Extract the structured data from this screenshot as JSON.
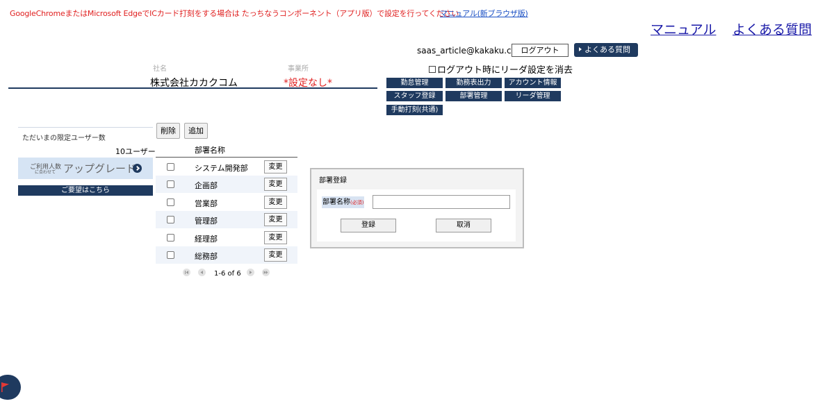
{
  "notice": {
    "text": "GoogleChromeまたはMicrosoft EdgeでICカード打刻をする場合は たっちなうコンポーネント（アプリ版）で設定を行ってください",
    "link": "マニュアル(新ブラウザ版)"
  },
  "top_links": {
    "manual": "マニュアル",
    "faq": "よくある質問"
  },
  "account": {
    "email": "saas_article@kakaku.com",
    "logout_button": "ログアウト",
    "faq_button": "よくある質問",
    "clear_reader_label": "ログアウト時にリーダ設定を消去"
  },
  "header": {
    "company_label": "社名",
    "company_value": "株式会社カカクコム",
    "office_label": "事業所",
    "office_value": "*設定なし*"
  },
  "nav": {
    "items": [
      "勤怠管理",
      "勤務表出力",
      "アカウント情報",
      "スタッフ登録",
      "部署管理",
      "リーダ管理",
      "手動打刻(共通)"
    ]
  },
  "sidebar": {
    "title": "ただいまの限定ユーザー数",
    "user_count": "10ユーザー",
    "upgrade_line1": "ご利用人数",
    "upgrade_line2": "に合わせて",
    "upgrade_main": "アップグレード",
    "request_button": "ご要望はこちら"
  },
  "toolbar": {
    "delete_button": "削除",
    "add_button": "追加"
  },
  "table": {
    "column_header": "部署名称",
    "change_label": "変更",
    "rows": [
      "システム開発部",
      "企画部",
      "営業部",
      "管理部",
      "経理部",
      "総務部"
    ]
  },
  "pager": {
    "text": "1-6 of 6"
  },
  "dialog": {
    "title": "部署登録",
    "field_label": "部署名称",
    "required_mark": "(必須)",
    "field_value": "",
    "register_button": "登録",
    "cancel_button": "取消"
  },
  "colors": {
    "navy": "#1f3a5f",
    "alert_red": "#e02020",
    "link_blue": "#1a1aa8"
  },
  "icons": {
    "flag": "flag-icon",
    "upgrade_arrow": "chevron-right-icon"
  }
}
